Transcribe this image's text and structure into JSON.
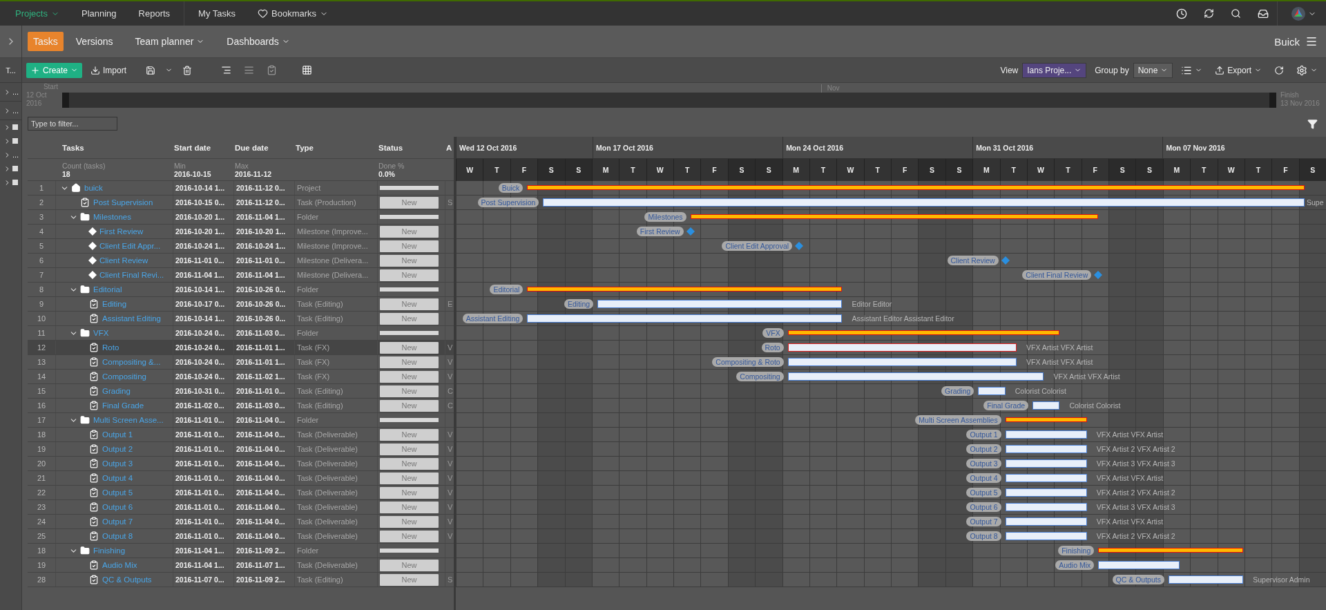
{
  "top_nav": {
    "items": [
      {
        "label": "Projects",
        "kind": "menu",
        "selected": true
      },
      {
        "label": "Planning",
        "kind": "link",
        "selected": false
      },
      {
        "label": "Reports",
        "kind": "link",
        "selected": false
      },
      {
        "label": "My Tasks",
        "kind": "link",
        "selected": false
      },
      {
        "label": "Bookmarks",
        "kind": "bookmarks",
        "selected": false
      }
    ]
  },
  "sub_nav": {
    "tabs": [
      {
        "label": "Tasks",
        "dropdown": false,
        "selected": true
      },
      {
        "label": "Versions",
        "dropdown": false,
        "selected": false
      },
      {
        "label": "Team planner",
        "dropdown": true,
        "selected": false
      },
      {
        "label": "Dashboards",
        "dropdown": true,
        "selected": false
      }
    ],
    "project": "Buick"
  },
  "left_rail": {
    "title": "T...",
    "items": [
      {
        "kind": "ellipsis",
        "text": "..."
      },
      {
        "kind": "ellipsis",
        "text": "..."
      },
      {
        "kind": "square"
      },
      {
        "kind": "square"
      },
      {
        "kind": "ellipsis",
        "text": "..."
      },
      {
        "kind": "square"
      },
      {
        "kind": "square"
      }
    ]
  },
  "toolbar": {
    "create": "Create",
    "import": "Import",
    "view_label": "View",
    "view_value": "Ians Proje...",
    "group_label": "Group by",
    "group_value": "None",
    "export": "Export"
  },
  "overview": {
    "start_label": "Start",
    "start_date": "12 Oct 2016",
    "month": "Nov",
    "finish_label": "Finish",
    "finish_date": "13 Nov 2016"
  },
  "filter": {
    "placeholder": "Type to filter..."
  },
  "table": {
    "columns": [
      {
        "label": "Tasks",
        "summary_label": "Count (tasks)",
        "summary_value": "18"
      },
      {
        "label": "Start date",
        "summary_label": "Min",
        "summary_value": "2016-10-15"
      },
      {
        "label": "Due date",
        "summary_label": "Max",
        "summary_value": "2016-11-12"
      },
      {
        "label": "Type"
      },
      {
        "label": "Status",
        "summary_label": "Done %",
        "summary_value": "0.0%"
      },
      {
        "label": "A"
      }
    ],
    "rows": [
      {
        "number": "1",
        "name": "buick",
        "kind": "project",
        "expanded": true,
        "selected": false,
        "start": "2016-10-14 1...",
        "due": "2016-11-12 0...",
        "type": "Project",
        "status": {
          "kind": "plain"
        },
        "bar": {
          "kind": "summary",
          "label": "Buick"
        },
        "children": [
          {
            "number": "2",
            "name": "Post Supervision",
            "kind": "task",
            "selected": false,
            "start": "2016-10-15 0...",
            "due": "2016-11-12 0...",
            "type": "Task (Production)",
            "status": {
              "kind": "badge",
              "text": "New"
            },
            "column_7": "S",
            "bar": {
              "kind": "task",
              "label": "Post Supervision",
              "resources": "Supe"
            }
          },
          {
            "number": "3",
            "name": "Milestones",
            "kind": "folder",
            "expanded": true,
            "selected": false,
            "start": "2016-10-20 1...",
            "due": "2016-11-04 1...",
            "type": "Folder",
            "status": {
              "kind": "plain"
            },
            "bar": {
              "kind": "summary",
              "label": "Milestones"
            },
            "children": [
              {
                "number": "4",
                "name": "First Review",
                "kind": "milestone",
                "selected": false,
                "start": "2016-10-20 1...",
                "due": "2016-10-20 1...",
                "type": "Milestone (Improve...",
                "status": {
                  "kind": "badge",
                  "text": "New"
                },
                "bar": {
                  "kind": "milestone",
                  "label": "First Review"
                }
              },
              {
                "number": "5",
                "name": "Client Edit Appr...",
                "kind": "milestone",
                "selected": false,
                "start": "2016-10-24 1...",
                "due": "2016-10-24 1...",
                "type": "Milestone (Improve...",
                "status": {
                  "kind": "badge",
                  "text": "New"
                },
                "bar": {
                  "kind": "milestone",
                  "label": "Client Edit Approval"
                }
              },
              {
                "number": "6",
                "name": "Client Review",
                "kind": "milestone",
                "selected": false,
                "start": "2016-11-01 0...",
                "due": "2016-11-01 0...",
                "type": "Milestone (Delivera...",
                "status": {
                  "kind": "badge",
                  "text": "New"
                },
                "bar": {
                  "kind": "milestone",
                  "label": "Client Review"
                }
              },
              {
                "number": "7",
                "name": "Client Final Revi...",
                "kind": "milestone",
                "selected": false,
                "start": "2016-11-04 1...",
                "due": "2016-11-04 1...",
                "type": "Milestone (Delivera...",
                "status": {
                  "kind": "badge",
                  "text": "New"
                },
                "bar": {
                  "kind": "milestone",
                  "label": "Client Final Review"
                }
              }
            ]
          },
          {
            "number": "8",
            "name": "Editorial",
            "kind": "folder",
            "expanded": true,
            "selected": false,
            "start": "2016-10-14 1...",
            "due": "2016-10-26 0...",
            "type": "Folder",
            "status": {
              "kind": "plain"
            },
            "bar": {
              "kind": "summary",
              "label": "Editorial"
            },
            "children": [
              {
                "number": "9",
                "name": "Editing",
                "kind": "task",
                "selected": false,
                "start": "2016-10-17 0...",
                "due": "2016-10-26 0...",
                "type": "Task (Editing)",
                "status": {
                  "kind": "badge",
                  "text": "New"
                },
                "column_7": "E",
                "bar": {
                  "kind": "task",
                  "label": "Editing",
                  "resources": "Editor Editor"
                }
              },
              {
                "number": "10",
                "name": "Assistant Editing",
                "kind": "task",
                "selected": false,
                "start": "2016-10-14 1...",
                "due": "2016-10-26 0...",
                "type": "Task (Editing)",
                "status": {
                  "kind": "badge",
                  "text": "New"
                },
                "bar": {
                  "kind": "task",
                  "label": "Assistant Editing",
                  "resources": "Assistant Editor Assistant Editor"
                }
              }
            ]
          },
          {
            "number": "11",
            "name": "VFX",
            "kind": "folder",
            "expanded": true,
            "selected": false,
            "start": "2016-10-24 0...",
            "due": "2016-11-03 0...",
            "type": "Folder",
            "status": {
              "kind": "plain"
            },
            "bar": {
              "kind": "summary",
              "label": "VFX"
            },
            "children": [
              {
                "number": "12",
                "name": "Roto",
                "kind": "task",
                "selected": true,
                "start": "2016-10-24 0...",
                "due": "2016-11-01 1...",
                "type": "Task (FX)",
                "status": {
                  "kind": "badge",
                  "text": "New"
                },
                "column_7": "V",
                "bar": {
                  "kind": "task",
                  "label": "Roto",
                  "resources": "VFX Artist VFX Artist"
                }
              },
              {
                "number": "13",
                "name": "Compositing &...",
                "kind": "task",
                "selected": false,
                "start": "2016-10-24 0...",
                "due": "2016-11-01 1...",
                "type": "Task (FX)",
                "status": {
                  "kind": "badge",
                  "text": "New"
                },
                "column_7": "V",
                "bar": {
                  "kind": "task",
                  "label": "Compositing & Roto",
                  "resources": "VFX Artist VFX Artist"
                }
              },
              {
                "number": "14",
                "name": "Compositing",
                "kind": "task",
                "selected": false,
                "start": "2016-10-24 0...",
                "due": "2016-11-02 1...",
                "type": "Task (FX)",
                "status": {
                  "kind": "badge",
                  "text": "New"
                },
                "column_7": "V",
                "bar": {
                  "kind": "task",
                  "label": "Compositing",
                  "resources": "VFX Artist VFX Artist"
                }
              },
              {
                "number": "15",
                "name": "Grading",
                "kind": "task",
                "selected": false,
                "start": "2016-10-31 0...",
                "due": "2016-11-01 0...",
                "type": "Task (Editing)",
                "status": {
                  "kind": "badge",
                  "text": "New"
                },
                "column_7": "C",
                "bar": {
                  "kind": "task",
                  "label": "Grading",
                  "resources": "Colorist Colorist"
                }
              },
              {
                "number": "16",
                "name": "Final Grade",
                "kind": "task",
                "selected": false,
                "start": "2016-11-02 0...",
                "due": "2016-11-03 0...",
                "type": "Task (Editing)",
                "status": {
                  "kind": "badge",
                  "text": "New"
                },
                "column_7": "C",
                "bar": {
                  "kind": "task",
                  "label": "Final Grade",
                  "resources": "Colorist Colorist"
                }
              }
            ]
          },
          {
            "number": "17",
            "name": "Multi Screen Asse...",
            "kind": "folder",
            "expanded": true,
            "selected": false,
            "start": "2016-11-01 0...",
            "due": "2016-11-04 0...",
            "type": "Folder",
            "status": {
              "kind": "plain"
            },
            "bar": {
              "kind": "summary",
              "label": "Multi Screen Assemblies"
            },
            "children": [
              {
                "number": "18",
                "name": "Output 1",
                "kind": "task",
                "selected": false,
                "start": "2016-11-01 0...",
                "due": "2016-11-04 0...",
                "type": "Task (Deliverable)",
                "status": {
                  "kind": "badge",
                  "text": "New"
                },
                "column_7": "V",
                "bar": {
                  "kind": "task",
                  "label": "Output 1",
                  "resources": "VFX Artist VFX Artist"
                }
              },
              {
                "number": "19",
                "name": "Output 2",
                "kind": "task",
                "selected": false,
                "start": "2016-11-01 0...",
                "due": "2016-11-04 0...",
                "type": "Task (Deliverable)",
                "status": {
                  "kind": "badge",
                  "text": "New"
                },
                "column_7": "V",
                "bar": {
                  "kind": "task",
                  "label": "Output 2",
                  "resources": "VFX Artist 2 VFX Artist 2"
                }
              },
              {
                "number": "20",
                "name": "Output 3",
                "kind": "task",
                "selected": false,
                "start": "2016-11-01 0...",
                "due": "2016-11-04 0...",
                "type": "Task (Deliverable)",
                "status": {
                  "kind": "badge",
                  "text": "New"
                },
                "column_7": "V",
                "bar": {
                  "kind": "task",
                  "label": "Output 3",
                  "resources": "VFX Artist 3 VFX Artist 3"
                }
              },
              {
                "number": "21",
                "name": "Output 4",
                "kind": "task",
                "selected": false,
                "start": "2016-11-01 0...",
                "due": "2016-11-04 0...",
                "type": "Task (Deliverable)",
                "status": {
                  "kind": "badge",
                  "text": "New"
                },
                "column_7": "V",
                "bar": {
                  "kind": "task",
                  "label": "Output 4",
                  "resources": "VFX Artist VFX Artist"
                }
              },
              {
                "number": "22",
                "name": "Output 5",
                "kind": "task",
                "selected": false,
                "start": "2016-11-01 0...",
                "due": "2016-11-04 0...",
                "type": "Task (Deliverable)",
                "status": {
                  "kind": "badge",
                  "text": "New"
                },
                "column_7": "V",
                "bar": {
                  "kind": "task",
                  "label": "Output 5",
                  "resources": "VFX Artist 2 VFX Artist 2"
                }
              },
              {
                "number": "23",
                "name": "Output 6",
                "kind": "task",
                "selected": false,
                "start": "2016-11-01 0...",
                "due": "2016-11-04 0...",
                "type": "Task (Deliverable)",
                "status": {
                  "kind": "badge",
                  "text": "New"
                },
                "column_7": "V",
                "bar": {
                  "kind": "task",
                  "label": "Output 6",
                  "resources": "VFX Artist 3 VFX Artist 3"
                }
              },
              {
                "number": "24",
                "name": "Output 7",
                "kind": "task",
                "selected": false,
                "start": "2016-11-01 0...",
                "due": "2016-11-04 0...",
                "type": "Task (Deliverable)",
                "status": {
                  "kind": "badge",
                  "text": "New"
                },
                "column_7": "V",
                "bar": {
                  "kind": "task",
                  "label": "Output 7",
                  "resources": "VFX Artist VFX Artist"
                }
              },
              {
                "number": "25",
                "name": "Output 8",
                "kind": "task",
                "selected": false,
                "start": "2016-11-01 0...",
                "due": "2016-11-04 0...",
                "type": "Task (Deliverable)",
                "status": {
                  "kind": "badge",
                  "text": "New"
                },
                "column_7": "V",
                "bar": {
                  "kind": "task",
                  "label": "Output 8",
                  "resources": "VFX Artist 2 VFX Artist 2"
                }
              }
            ]
          },
          {
            "number": "18",
            "name": "Finishing",
            "kind": "folder",
            "expanded": true,
            "selected": false,
            "start": "2016-11-04 1...",
            "due": "2016-11-09 2...",
            "type": "Folder",
            "status": {
              "kind": "plain"
            },
            "bar": {
              "kind": "summary",
              "label": "Finishing"
            },
            "children": [
              {
                "number": "19",
                "name": "Audio Mix",
                "kind": "task",
                "selected": false,
                "start": "2016-11-04 1...",
                "due": "2016-11-07 1...",
                "type": "Task (Deliverable)",
                "status": {
                  "kind": "badge",
                  "text": "New"
                },
                "bar": {
                  "kind": "task",
                  "label": "Audio Mix"
                }
              },
              {
                "number": "28",
                "name": "QC & Outputs",
                "kind": "task",
                "selected": false,
                "start": "2016-11-07 0...",
                "due": "2016-11-09 2...",
                "type": "Task (Editing)",
                "status": {
                  "kind": "badge",
                  "text": "New"
                },
                "column_7": "S",
                "bar": {
                  "kind": "task",
                  "label": "QC & Outputs",
                  "resources": "Supervisor Admin"
                }
              }
            ]
          }
        ]
      }
    ]
  },
  "gantt": {
    "weeks": [
      {
        "label": "Wed 12 Oct 2016",
        "days": [
          {
            "letter": "W",
            "weekend": false
          },
          {
            "letter": "T",
            "weekend": false
          },
          {
            "letter": "F",
            "weekend": false
          },
          {
            "letter": "S",
            "weekend": true
          },
          {
            "letter": "S",
            "weekend": true
          }
        ]
      },
      {
        "label": "Mon 17 Oct 2016",
        "days": [
          {
            "letter": "M",
            "weekend": false
          },
          {
            "letter": "T",
            "weekend": false
          },
          {
            "letter": "W",
            "weekend": false
          },
          {
            "letter": "T",
            "weekend": false
          },
          {
            "letter": "F",
            "weekend": false
          },
          {
            "letter": "S",
            "weekend": true
          },
          {
            "letter": "S",
            "weekend": true
          }
        ]
      },
      {
        "label": "Mon 24 Oct 2016",
        "days": [
          {
            "letter": "M",
            "weekend": false
          },
          {
            "letter": "T",
            "weekend": false
          },
          {
            "letter": "W",
            "weekend": false
          },
          {
            "letter": "T",
            "weekend": false
          },
          {
            "letter": "F",
            "weekend": false
          },
          {
            "letter": "S",
            "weekend": true
          },
          {
            "letter": "S",
            "weekend": true
          }
        ]
      },
      {
        "label": "Mon 31 Oct 2016",
        "days": [
          {
            "letter": "M",
            "weekend": false
          },
          {
            "letter": "T",
            "weekend": false
          },
          {
            "letter": "W",
            "weekend": false
          },
          {
            "letter": "T",
            "weekend": false
          },
          {
            "letter": "F",
            "weekend": false
          },
          {
            "letter": "S",
            "weekend": true
          },
          {
            "letter": "S",
            "weekend": true
          }
        ]
      },
      {
        "label": "Mon 07 Nov 2016",
        "days": [
          {
            "letter": "M",
            "weekend": false
          },
          {
            "letter": "T",
            "weekend": false
          },
          {
            "letter": "W",
            "weekend": false
          },
          {
            "letter": "T",
            "weekend": false
          },
          {
            "letter": "F",
            "weekend": false
          },
          {
            "letter": "S",
            "weekend": true
          }
        ]
      }
    ]
  }
}
